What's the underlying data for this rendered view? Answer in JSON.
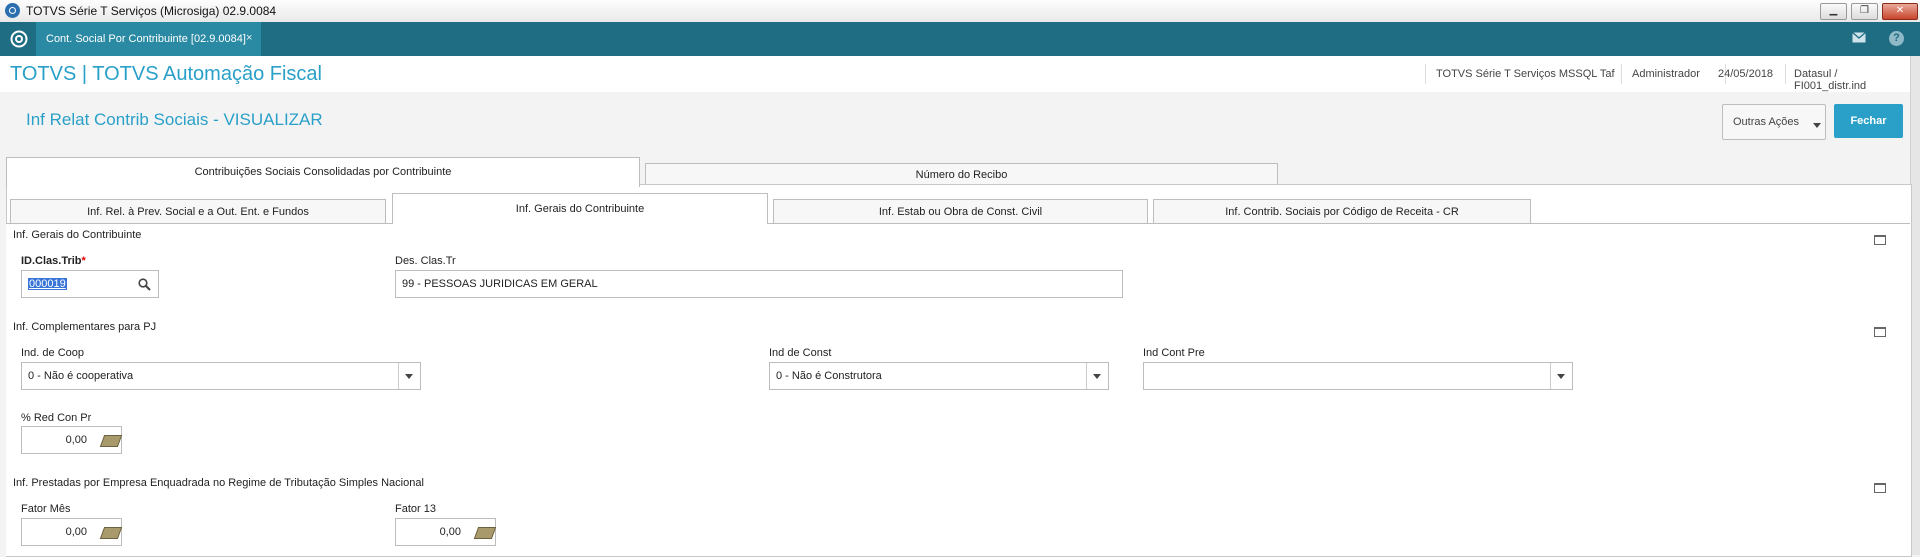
{
  "window": {
    "title": "TOTVS Série T Serviços (Microsiga) 02.9.0084",
    "min": "▁",
    "max": "❐",
    "close": "✕"
  },
  "tabbar": {
    "tab_label": "Cont. Social Por Contribuinte [02.9.0084]",
    "tab_close": "×",
    "help": "?"
  },
  "header": {
    "brand": "TOTVS | TOTVS Automação Fiscal",
    "environment": "TOTVS Série T Serviços MSSQL Taf",
    "user": "Administrador",
    "date": "24/05/2018",
    "company": "Datasul / FI001_distr.ind"
  },
  "page": {
    "title": "Inf Relat Contrib Sociais - VISUALIZAR",
    "more_actions": "Outras Ações",
    "close": "Fechar"
  },
  "outer_tabs": [
    "Contribuições Sociais Consolidadas por Contribuinte",
    "Número do Recibo"
  ],
  "inner_tabs": [
    "Inf. Rel. à Prev. Social e a Out. Ent. e Fundos",
    "Inf. Gerais do Contribuinte",
    "Inf. Estab ou Obra de Const. Civil",
    "Inf. Contrib. Sociais por Código de Receita - CR"
  ],
  "sections": {
    "gerais": {
      "title": "Inf. Gerais do Contribuinte",
      "id_label": "ID.Clas.Trib",
      "id_required": "*",
      "id_value": "000019",
      "des_label": "Des. Clas.Tr",
      "des_value": "99 - PESSOAS JURIDICAS EM GERAL"
    },
    "complementares": {
      "title": "Inf. Complementares para PJ",
      "coop_label": "Ind. de Coop",
      "coop_value": "0 - Não é cooperativa",
      "const_label": "Ind de Const",
      "const_value": "0 - Não é Construtora",
      "contpre_label": "Ind Cont Pre",
      "contpre_value": "",
      "red_label": "% Red Con Pr",
      "red_value": "0,00"
    },
    "simples": {
      "title": "Inf. Prestadas por Empresa Enquadrada no Regime de Tributação Simples Nacional",
      "mes_label": "Fator Mês",
      "mes_value": "0,00",
      "f13_label": "Fator 13",
      "f13_value": "0,00"
    }
  },
  "colors": {
    "accent": "#2aa0c9",
    "tabbar": "#1f6d83",
    "selection": "#3875d7"
  }
}
